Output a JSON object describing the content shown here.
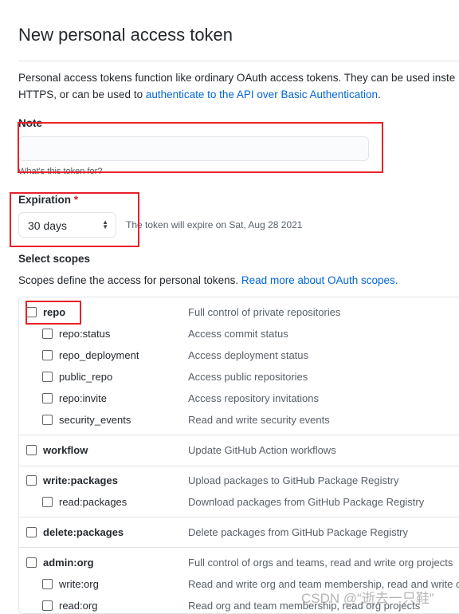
{
  "title": "New personal access token",
  "intro": {
    "line1": "Personal access tokens function like ordinary OAuth access tokens. They can be used inste",
    "line2_prefix": "HTTPS, or can be used to ",
    "link": "authenticate to the API over Basic Authentication",
    "line2_suffix": "."
  },
  "note": {
    "label": "Note",
    "value": "",
    "help": "What's this token for?"
  },
  "expiration": {
    "label": "Expiration",
    "required": "*",
    "selected": "30 days",
    "hint": "The token will expire on Sat, Aug 28 2021"
  },
  "scopes": {
    "heading": "Select scopes",
    "desc": "Scopes define the access for personal tokens. ",
    "link": "Read more about OAuth scopes.",
    "rows": [
      {
        "name": "repo",
        "desc": "Full control of private repositories",
        "top": true,
        "checked": false
      },
      {
        "name": "repo:status",
        "desc": "Access commit status",
        "top": false,
        "checked": false
      },
      {
        "name": "repo_deployment",
        "desc": "Access deployment status",
        "top": false,
        "checked": false
      },
      {
        "name": "public_repo",
        "desc": "Access public repositories",
        "top": false,
        "checked": false
      },
      {
        "name": "repo:invite",
        "desc": "Access repository invitations",
        "top": false,
        "checked": false
      },
      {
        "name": "security_events",
        "desc": "Read and write security events",
        "top": false,
        "checked": false
      },
      {
        "name": "workflow",
        "desc": "Update GitHub Action workflows",
        "top": true,
        "checked": false
      },
      {
        "name": "write:packages",
        "desc": "Upload packages to GitHub Package Registry",
        "top": true,
        "checked": false
      },
      {
        "name": "read:packages",
        "desc": "Download packages from GitHub Package Registry",
        "top": false,
        "checked": false
      },
      {
        "name": "delete:packages",
        "desc": "Delete packages from GitHub Package Registry",
        "top": true,
        "checked": false
      },
      {
        "name": "admin:org",
        "desc": "Full control of orgs and teams, read and write org projects",
        "top": true,
        "checked": false
      },
      {
        "name": "write:org",
        "desc": "Read and write org and team membership, read and write o",
        "top": false,
        "checked": false
      },
      {
        "name": "read:org",
        "desc": "Read org and team membership, read org projects",
        "top": false,
        "checked": false
      }
    ]
  },
  "colors": {
    "link": "#0366d6",
    "highlight": "#e8212b",
    "required": "#cb2431"
  },
  "watermark": "CSDN @“逝去一只鞋”"
}
